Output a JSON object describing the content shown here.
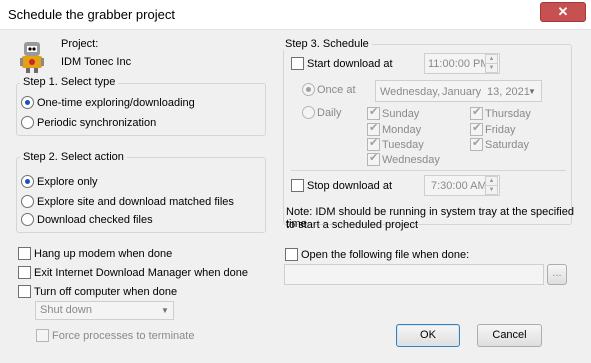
{
  "window": {
    "title": "Schedule the grabber project",
    "close_label": "✕"
  },
  "project": {
    "label": "Project:",
    "name": "IDM Tonec Inc"
  },
  "step1": {
    "title": "Step 1. Select type",
    "options": [
      "One-time exploring/downloading",
      "Periodic synchronization"
    ],
    "selected": 0
  },
  "step2": {
    "title": "Step 2. Select action",
    "options": [
      "Explore only",
      "Explore site and download matched files",
      "Download checked files"
    ],
    "selected": 0
  },
  "post_options": {
    "hangup": "Hang up modem when done",
    "exit_idm": "Exit Internet Download Manager when done",
    "turn_off": "Turn off computer when done",
    "shutdown_value": "Shut down",
    "force_label": "Force processes to terminate"
  },
  "step3": {
    "title": "Step 3. Schedule",
    "start_label": "Start download at",
    "start_time": "11:00:00 PM",
    "once_label": "Once at",
    "date_day": "Wednesday,",
    "date_month": "January",
    "date_rest": "13, 2021",
    "daily_label": "Daily",
    "days": [
      {
        "name": "Sunday",
        "checked": true
      },
      {
        "name": "Monday",
        "checked": true
      },
      {
        "name": "Tuesday",
        "checked": true
      },
      {
        "name": "Wednesday",
        "checked": true
      },
      {
        "name": "Thursday",
        "checked": true
      },
      {
        "name": "Friday",
        "checked": true
      },
      {
        "name": "Saturday",
        "checked": true
      }
    ],
    "stop_label": "Stop download at",
    "stop_time": "7:30:00 AM",
    "note_line1": "Note: IDM should be running in system tray at the specified time",
    "note_line2": "to start a scheduled project"
  },
  "open_file": {
    "label": "Open the following file when done:",
    "path": "",
    "browse_label": "..."
  },
  "buttons": {
    "ok": "OK",
    "cancel": "Cancel"
  }
}
